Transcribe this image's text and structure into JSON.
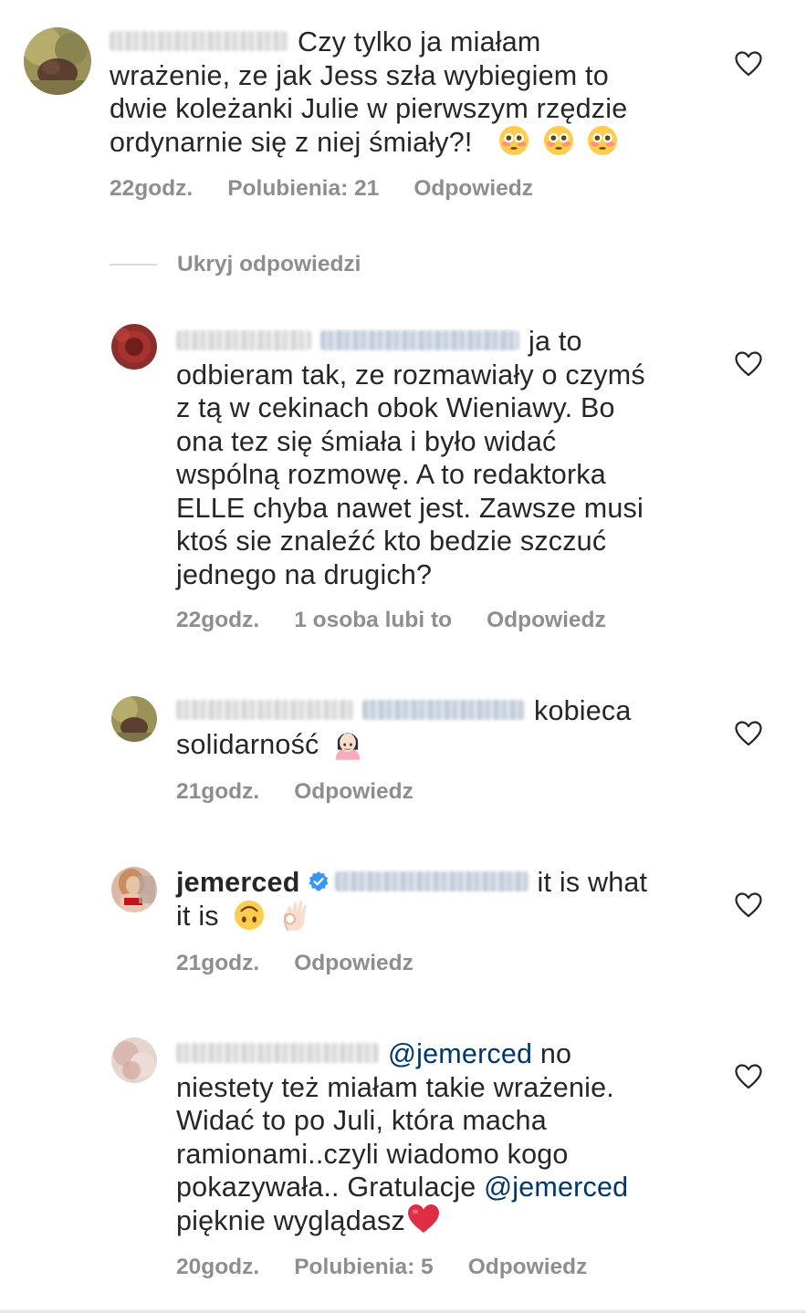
{
  "comments": [
    {
      "text_lines": [
        "Czy tylko ja miałam",
        "wrażenie, ze jak Jess szła wybiegiem to",
        "dwie koleżanki Julie w pierwszym rzędzie",
        "ordynarnie się z niej śmiały?!"
      ],
      "time": "22godz.",
      "likes": "Polubienia: 21",
      "reply_label": "Odpowiedz",
      "emojis": [
        "flushed-face-emoji",
        "flushed-face-emoji",
        "flushed-face-emoji"
      ]
    }
  ],
  "hide_replies_label": "Ukryj odpowiedzi",
  "replies": [
    {
      "first_line": "ja to",
      "text_lines": [
        "odbieram tak, ze rozmawiały o czymś",
        "z tą w cekinach obok Wieniawy. Bo",
        "ona tez się śmiała i było widać",
        "wspólną rozmowę. A to redaktorka",
        "ELLE chyba nawet jest. Zawsze musi",
        "ktoś sie znaleźć kto bedzie szczuć",
        "jednego na drugich?"
      ],
      "time": "22godz.",
      "likes": "1 osoba lubi to",
      "reply_label": "Odpowiedz"
    },
    {
      "first_line": "kobieca",
      "text_lines": [
        "solidarność"
      ],
      "time": "21godz.",
      "reply_label": "Odpowiedz",
      "emojis": [
        "woman-facepalming-emoji"
      ]
    },
    {
      "username": "jemerced",
      "first_line": "it is what",
      "text_lines": [
        "it is"
      ],
      "time": "21godz.",
      "reply_label": "Odpowiedz",
      "emojis": [
        "upside-down-face-emoji",
        "ok-hand-emoji"
      ]
    },
    {
      "mention": "@jemerced",
      "first_line": "no",
      "text_lines": [
        "niestety też miałam takie wrażenie.",
        "Widać to po Juli, która macha",
        "ramionami..czyli wiadomo kogo",
        "pokazywała.. Gratulacje"
      ],
      "mention2": "@jemerced",
      "last_line": "pięknie wyglądasz",
      "time": "20godz.",
      "likes": "Polubienia: 5",
      "reply_label": "Odpowiedz",
      "emojis": [
        "red-heart-emoji"
      ]
    }
  ],
  "colors": {
    "text": "#262626",
    "meta": "#8e8e8e",
    "mention": "#00376b",
    "verified": "#3897f0"
  }
}
